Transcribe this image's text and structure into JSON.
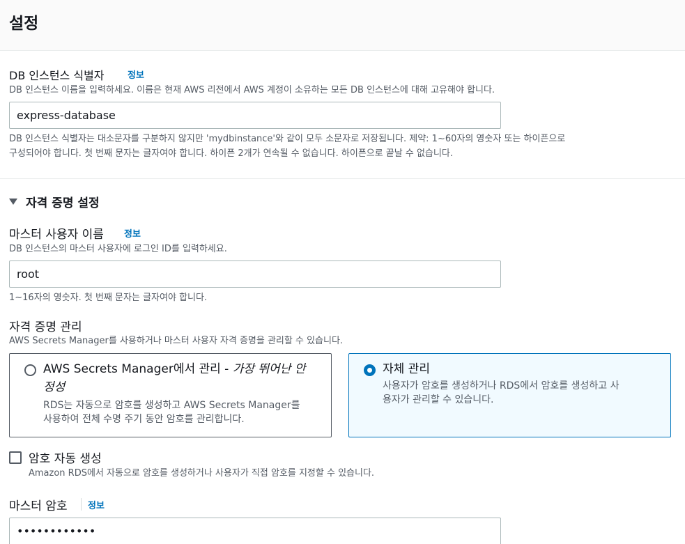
{
  "header": {
    "title": "설정"
  },
  "db_identifier": {
    "label": "DB 인스턴스 식별자",
    "info": "정보",
    "description": "DB 인스턴스 이름을 입력하세요. 이름은 현재 AWS 리전에서 AWS 계정이 소유하는 모든 DB 인스턴스에 대해 고유해야 합니다.",
    "value": "express-database",
    "constraint_line1": "DB 인스턴스 식별자는 대소문자를 구분하지 않지만 'mydbinstance'와 같이 모두 소문자로 저장됩니다. 제약: 1~60자의 영숫자 또는 하이픈으로",
    "constraint_line2": "구성되어야 합니다. 첫 번째 문자는 글자여야 합니다. 하이픈 2개가 연속될 수 없습니다. 하이픈으로 끝날 수 없습니다."
  },
  "credentials": {
    "section_title": "자격 증명 설정",
    "master_username": {
      "label": "마스터 사용자 이름",
      "info": "정보",
      "description": "DB 인스턴스의 마스터 사용자에 로그인 ID를 입력하세요.",
      "value": "root",
      "constraint": "1~16자의 영숫자. 첫 번째 문자는 글자여야 합니다."
    },
    "management": {
      "label": "자격 증명 관리",
      "description": "AWS Secrets Manager를 사용하거나 마스터 사용자 자격 증명을 관리할 수 있습니다.",
      "options": [
        {
          "title_prefix": "AWS Secrets Manager에서 관리 - ",
          "title_italic_1": "가장 뛰어난 안",
          "title_italic_2": "정성",
          "desc_line1": "RDS는 자동으로 암호를 생성하고 AWS Secrets Manager를",
          "desc_line2": "사용하여 전체 수명 주기 동안 암호를 관리합니다.",
          "selected": false
        },
        {
          "title": "자체 관리",
          "desc_line1": "사용자가 암호를 생성하거나 RDS에서 암호를 생성하고 사",
          "desc_line2": "용자가 관리할 수 있습니다.",
          "selected": true
        }
      ]
    },
    "auto_generate": {
      "label": "암호 자동 생성",
      "description": "Amazon RDS에서 자동으로 암호를 생성하거나 사용자가 직접 암호를 지정할 수 있습니다.",
      "checked": false
    },
    "master_password": {
      "label": "마스터 암호",
      "info": "정보",
      "value": "••••••••••••"
    }
  },
  "colors": {
    "link": "#0073bb",
    "selected_tile_bg": "#f1faff",
    "text_secondary": "#545b64"
  }
}
